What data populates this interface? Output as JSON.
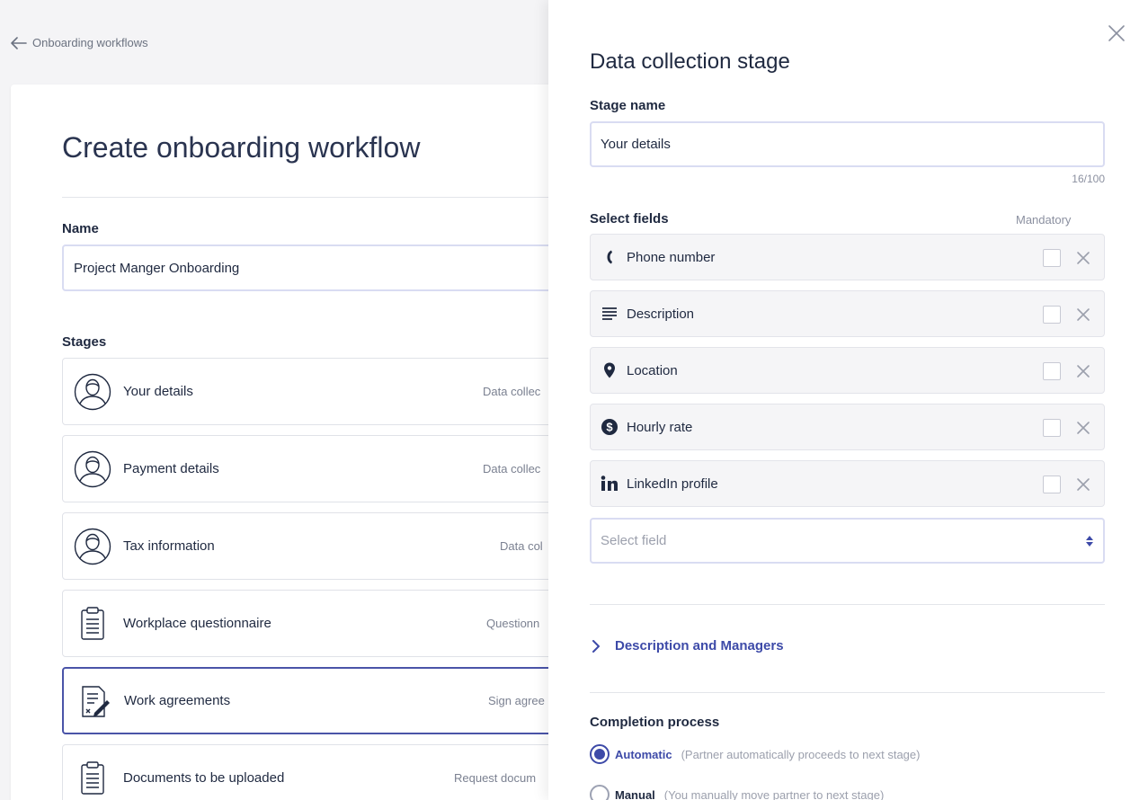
{
  "back_link": {
    "label": "Onboarding workflows"
  },
  "page": {
    "title": "Create onboarding workflow",
    "name_label": "Name",
    "name_value": "Project Manger Onboarding",
    "stages_label": "Stages",
    "stages": [
      {
        "name": "Your details",
        "type": "Data collec",
        "icon": "user-avatar-icon"
      },
      {
        "name": "Payment details",
        "type": "Data collec",
        "icon": "user-avatar-icon"
      },
      {
        "name": "Tax information",
        "type": "Data col",
        "icon": "user-avatar-icon"
      },
      {
        "name": "Workplace questionnaire",
        "type": "Questionn",
        "icon": "clipboard-icon"
      },
      {
        "name": "Work agreements",
        "type": "Sign agree",
        "icon": "signature-document-icon",
        "selected": true
      },
      {
        "name": "Documents to be uploaded",
        "type": "Request docum",
        "icon": "clipboard-icon"
      }
    ]
  },
  "panel": {
    "title": "Data collection stage",
    "stage_name_label": "Stage name",
    "stage_name_value": "Your details",
    "char_count": "16/100",
    "select_fields_label": "Select fields",
    "mandatory_label": "Mandatory",
    "fields": [
      {
        "label": "Phone number",
        "icon": "phone-icon",
        "mandatory": false
      },
      {
        "label": "Description",
        "icon": "text-lines-icon",
        "mandatory": false
      },
      {
        "label": "Location",
        "icon": "location-pin-icon",
        "mandatory": false
      },
      {
        "label": "Hourly rate",
        "icon": "dollar-icon",
        "mandatory": false
      },
      {
        "label": "LinkedIn profile",
        "icon": "linkedin-icon",
        "mandatory": false
      }
    ],
    "select_field_placeholder": "Select field",
    "description_managers_label": "Description and Managers",
    "completion_label": "Completion process",
    "completion_options": [
      {
        "label": "Automatic",
        "hint": "(Partner automatically proceeds to next stage)",
        "selected": true
      },
      {
        "label": "Manual",
        "hint": "(You manually move partner to next stage)",
        "selected": false
      }
    ]
  },
  "colors": {
    "accent": "#3d4aa8",
    "text": "#1f2940",
    "muted": "#7b8191",
    "border": "#d9dcf2"
  }
}
